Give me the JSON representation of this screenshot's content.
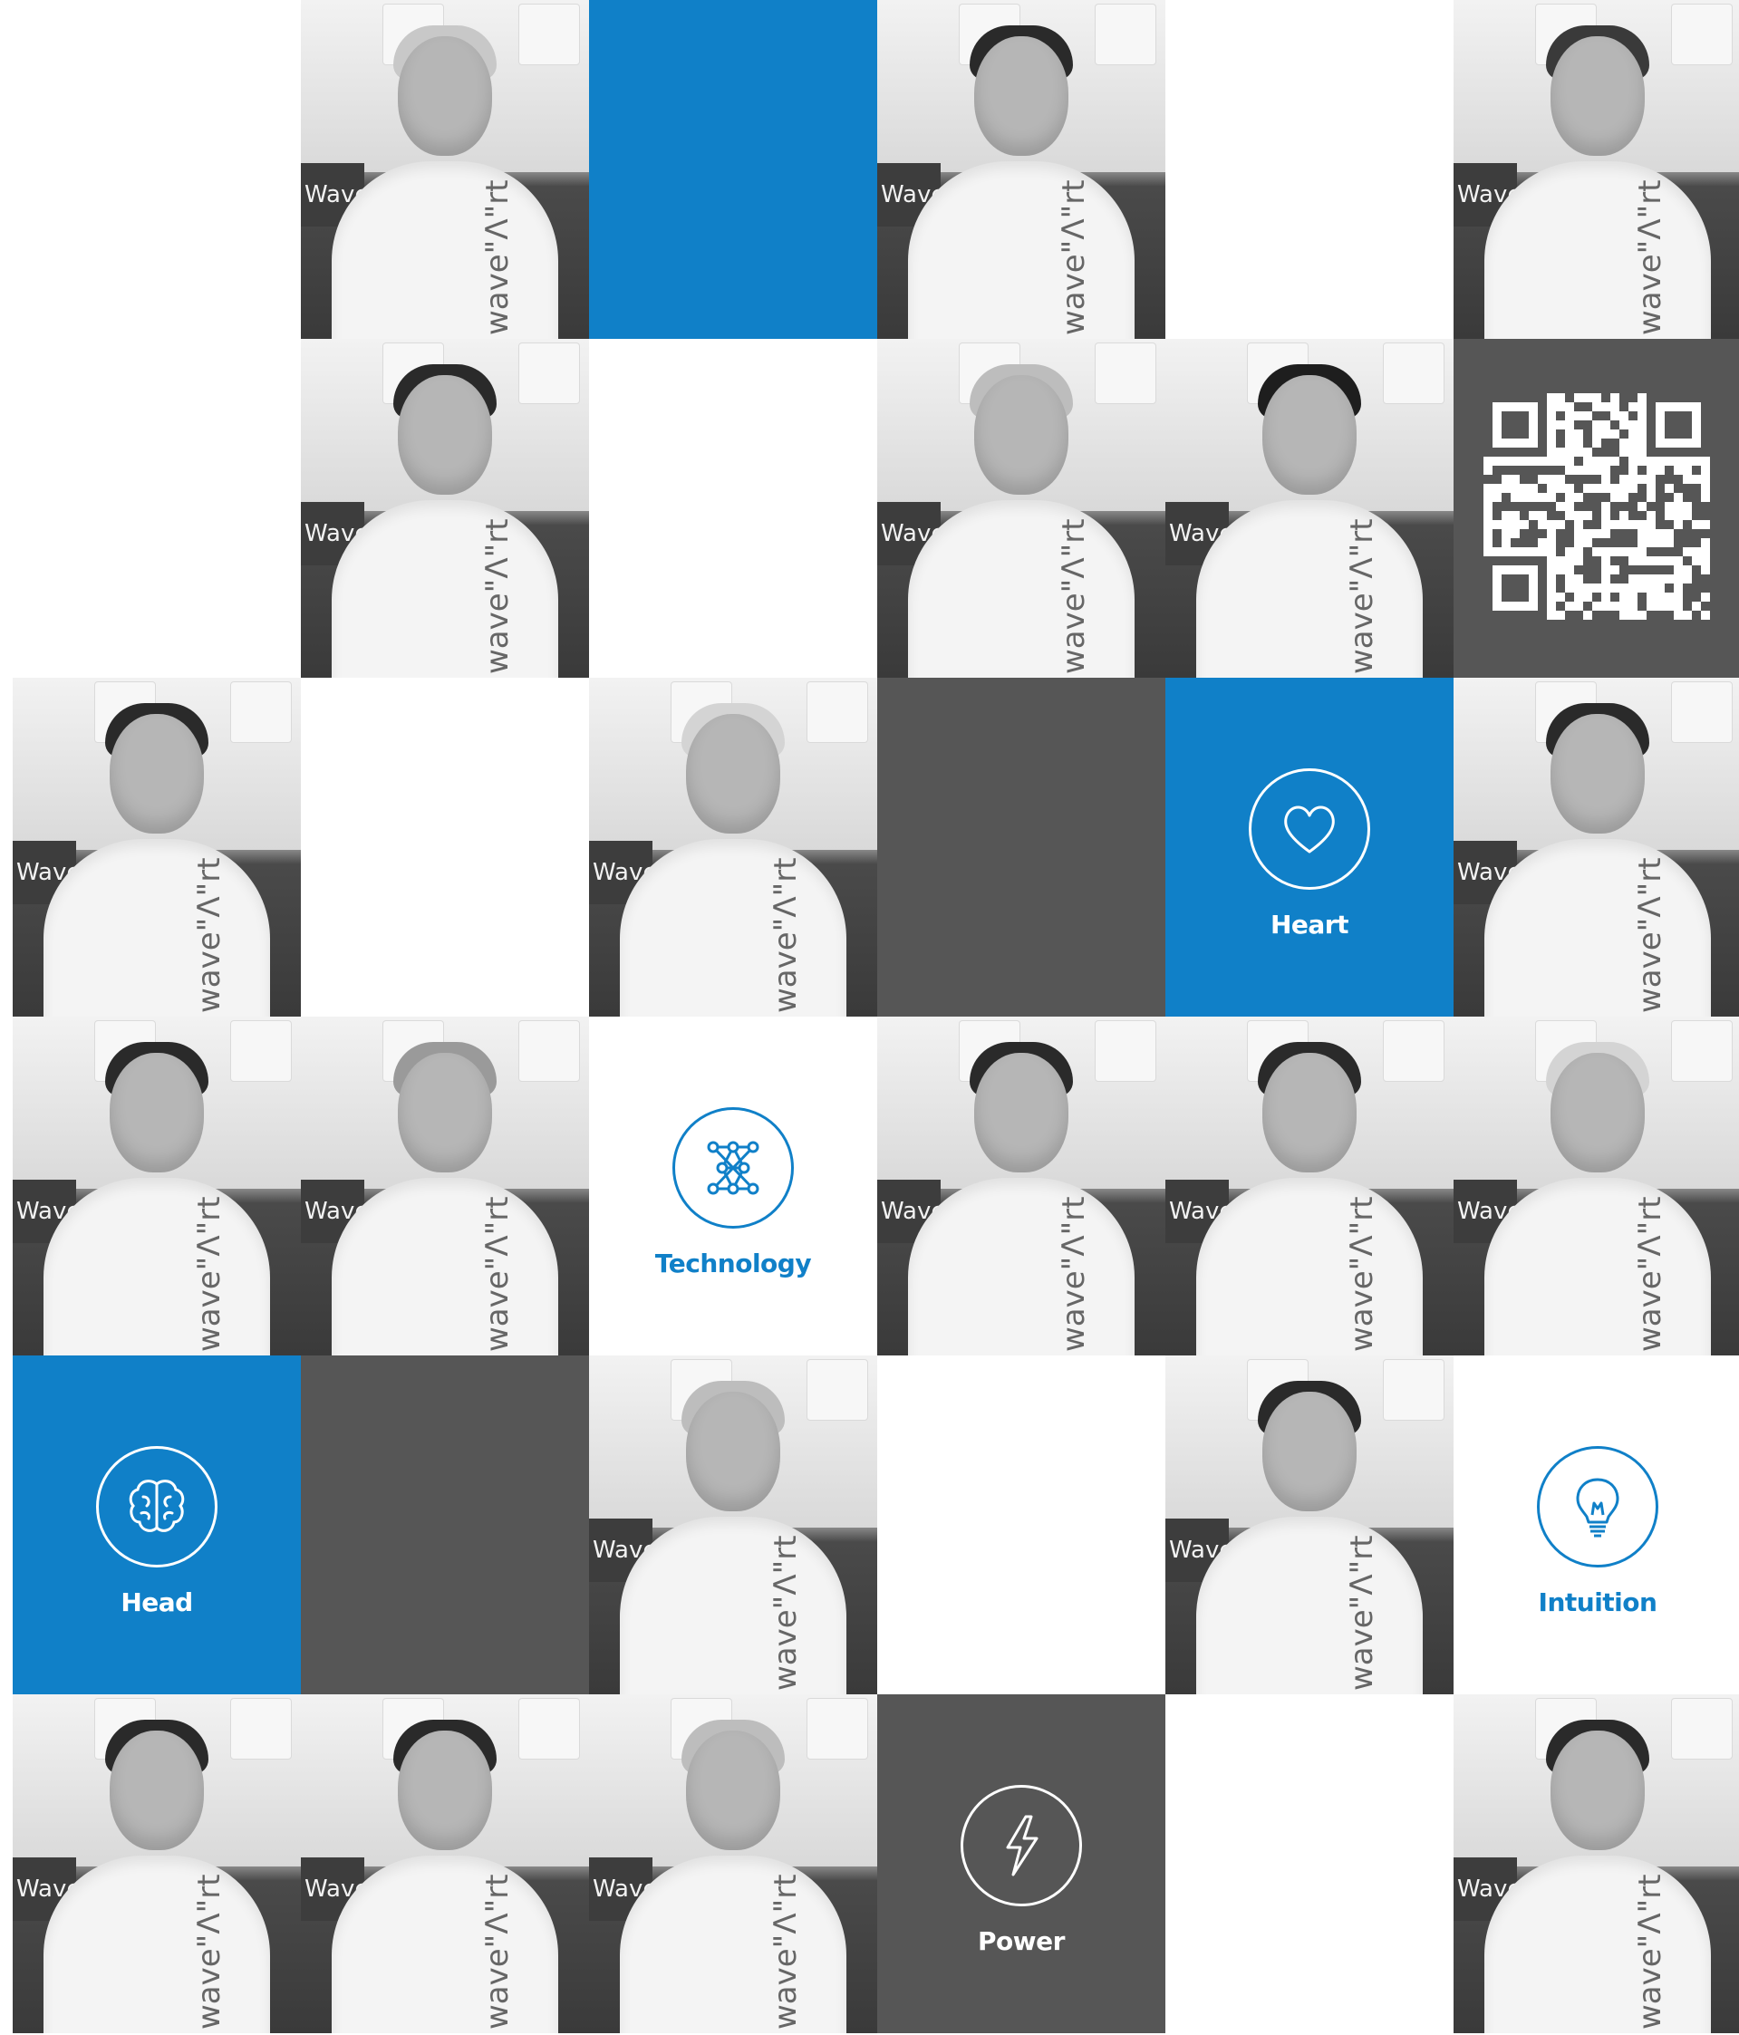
{
  "brand": "WaveArt",
  "colors": {
    "blue": "#1080c8",
    "gray": "#565656",
    "white": "#ffffff"
  },
  "tiles": [
    {
      "row": 1,
      "col": 1,
      "type": "white"
    },
    {
      "row": 1,
      "col": 2,
      "type": "photo",
      "hair": "#c8c8c8"
    },
    {
      "row": 1,
      "col": 3,
      "type": "blue"
    },
    {
      "row": 1,
      "col": 4,
      "type": "photo",
      "hair": "#2a2a2a"
    },
    {
      "row": 1,
      "col": 5,
      "type": "white"
    },
    {
      "row": 1,
      "col": 6,
      "type": "photo",
      "hair": "#3a3a3a"
    },
    {
      "row": 2,
      "col": 1,
      "type": "white"
    },
    {
      "row": 2,
      "col": 2,
      "type": "photo",
      "hair": "#2a2a2a"
    },
    {
      "row": 2,
      "col": 3,
      "type": "white"
    },
    {
      "row": 2,
      "col": 4,
      "type": "photo",
      "hair": "#bdbdbd"
    },
    {
      "row": 2,
      "col": 5,
      "type": "photo",
      "hair": "#1e1e1e"
    },
    {
      "row": 2,
      "col": 6,
      "type": "qr"
    },
    {
      "row": 3,
      "col": 1,
      "type": "photo",
      "hair": "#2a2a2a"
    },
    {
      "row": 3,
      "col": 2,
      "type": "white"
    },
    {
      "row": 3,
      "col": 3,
      "type": "photo",
      "hair": "#d4d4d4"
    },
    {
      "row": 3,
      "col": 4,
      "type": "gray"
    },
    {
      "row": 3,
      "col": 5,
      "type": "value",
      "bg": "blue",
      "icon": "heart-icon",
      "label": "Heart"
    },
    {
      "row": 3,
      "col": 6,
      "type": "photo",
      "hair": "#2a2a2a"
    },
    {
      "row": 4,
      "col": 1,
      "type": "photo",
      "hair": "#2a2a2a"
    },
    {
      "row": 4,
      "col": 2,
      "type": "photo",
      "hair": "#9a9a9a"
    },
    {
      "row": 4,
      "col": 3,
      "type": "value",
      "bg": "white",
      "icon": "network-icon",
      "label": "Technology"
    },
    {
      "row": 4,
      "col": 4,
      "type": "photo",
      "hair": "#2a2a2a"
    },
    {
      "row": 4,
      "col": 5,
      "type": "photo",
      "hair": "#2a2a2a"
    },
    {
      "row": 4,
      "col": 6,
      "type": "photo",
      "hair": "#d4d4d4"
    },
    {
      "row": 5,
      "col": 1,
      "type": "value",
      "bg": "blue",
      "icon": "brain-icon",
      "label": "Head"
    },
    {
      "row": 5,
      "col": 2,
      "type": "gray"
    },
    {
      "row": 5,
      "col": 3,
      "type": "photo",
      "hair": "#bdbdbd"
    },
    {
      "row": 5,
      "col": 4,
      "type": "white"
    },
    {
      "row": 5,
      "col": 5,
      "type": "photo",
      "hair": "#2a2a2a"
    },
    {
      "row": 5,
      "col": 6,
      "type": "value",
      "bg": "white",
      "icon": "lightbulb-icon",
      "label": "Intuition"
    },
    {
      "row": 6,
      "col": 1,
      "type": "photo",
      "hair": "#2a2a2a"
    },
    {
      "row": 6,
      "col": 2,
      "type": "photo",
      "hair": "#2a2a2a"
    },
    {
      "row": 6,
      "col": 3,
      "type": "photo",
      "hair": "#bdbdbd"
    },
    {
      "row": 6,
      "col": 4,
      "type": "value",
      "bg": "gray",
      "icon": "lightning-icon",
      "label": "Power"
    },
    {
      "row": 6,
      "col": 5,
      "type": "white"
    },
    {
      "row": 6,
      "col": 6,
      "type": "photo",
      "hair": "#2a2a2a"
    }
  ]
}
